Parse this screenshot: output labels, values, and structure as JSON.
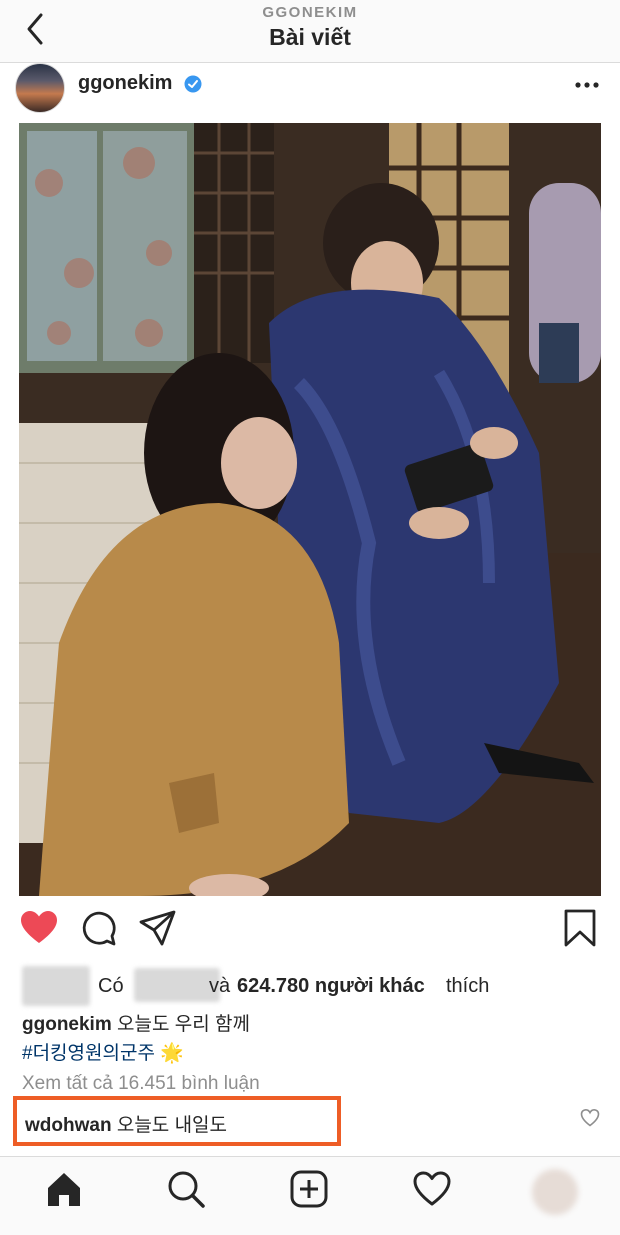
{
  "header": {
    "account_name": "GGONEKIM",
    "title": "Bài viết",
    "back_icon": "chevron-left-icon"
  },
  "post": {
    "username": "ggonekim",
    "verified": true,
    "more_icon": "more-horizontal-icon",
    "photo_description_icon": "photo"
  },
  "actions": {
    "like_icon": "heart-filled-icon",
    "comment_icon": "comment-icon",
    "share_icon": "send-icon",
    "save_icon": "bookmark-icon",
    "like_color": "#ed4956"
  },
  "likes": {
    "prefix": "Có",
    "and": "và",
    "count": "624.780 người khác",
    "suffix": "thích"
  },
  "caption": {
    "username": "ggonekim",
    "text": "오늘도 우리 함께",
    "hashtag": "#더킹영원의군주 🌟"
  },
  "comments": {
    "view_all": "Xem tất cả 16.451 bình luận",
    "highlighted": {
      "username": "wdohwan",
      "text": "오늘도 내일도"
    },
    "highlight_color": "#ee5d26"
  },
  "bottom_nav": {
    "items": [
      "home-icon",
      "search-icon",
      "add-post-icon",
      "activity-heart-icon",
      "profile-avatar"
    ]
  }
}
